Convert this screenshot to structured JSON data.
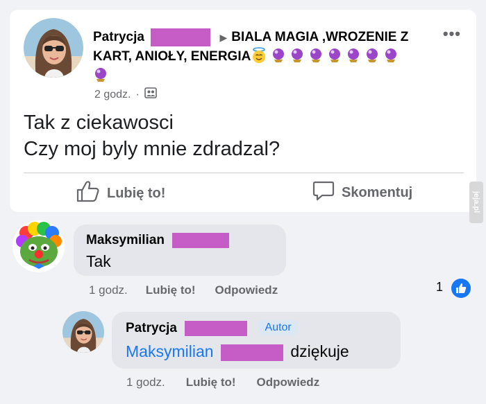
{
  "post": {
    "author": "Patrycja",
    "group": "BIALA MAGIA ,WROZENIE Z KART, ANIOŁY, ENERGIA",
    "time": "2 godz.",
    "separator": "·",
    "body_line1": "Tak z ciekawosci",
    "body_line2": "Czy moj byly mnie zdradzal?",
    "like_label": "Lubię to!",
    "comment_label": "Skomentuj",
    "more": "•••"
  },
  "comments": [
    {
      "author": "Maksymilian",
      "text": "Tak",
      "time": "1 godz.",
      "like_label": "Lubię to!",
      "reply_label": "Odpowiedz",
      "reaction_count": "1"
    },
    {
      "author": "Patrycja",
      "badge": "Autor",
      "mention": "Maksymilian",
      "text": "dziękuje",
      "time": "1 godz.",
      "like_label": "Lubię to!",
      "reply_label": "Odpowiedz"
    }
  ],
  "watermark": "jeja.pl",
  "colors": {
    "accent": "#1877f2",
    "redaction": "#c65dc6",
    "background": "#f0f2f5"
  }
}
